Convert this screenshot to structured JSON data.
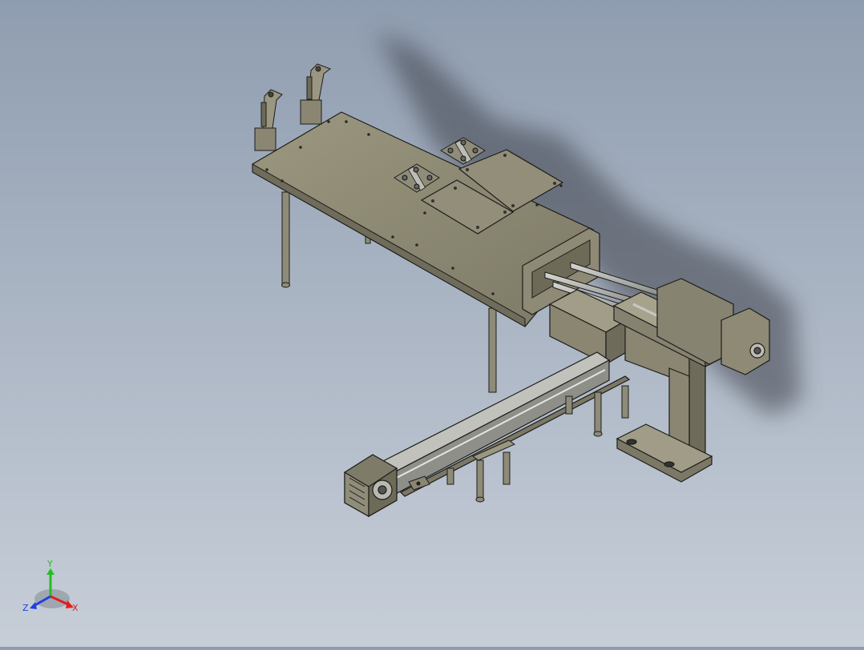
{
  "viewport": {
    "background_top": "#8f9db0",
    "background_bottom": "#c7ced8",
    "part_color": "#8a8672",
    "part_edge": "#1d1d1a"
  },
  "triad": {
    "x_label": "X",
    "y_label": "Y",
    "z_label": "Z",
    "x_color": "#e02020",
    "y_color": "#20c020",
    "z_color": "#2040e0"
  }
}
